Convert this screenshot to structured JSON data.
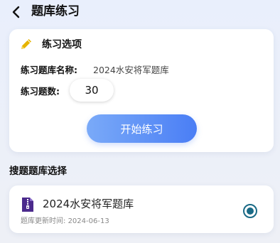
{
  "header": {
    "back_icon": "chevron-left-icon",
    "title": "题库练习"
  },
  "options": {
    "icon": "pencil-icon",
    "title": "练习选项",
    "bank_name_label": "练习题库名称:",
    "bank_name_value": "2024水安将军题库",
    "count_label": "练习题数:",
    "count_value": "30",
    "start_button": "开始练习"
  },
  "bank_section": {
    "title": "搜题题库选择",
    "items": [
      {
        "icon": "archive-file-icon",
        "name": "2024水安将军题库",
        "update_label": "题库更新时间:",
        "update_date": "2024-06-13",
        "selected": true
      }
    ]
  },
  "colors": {
    "accent": "#4a7ef5",
    "radio": "#1a6a86",
    "pencil": "#e6b400",
    "archive_icon": "#4b2a8c"
  }
}
